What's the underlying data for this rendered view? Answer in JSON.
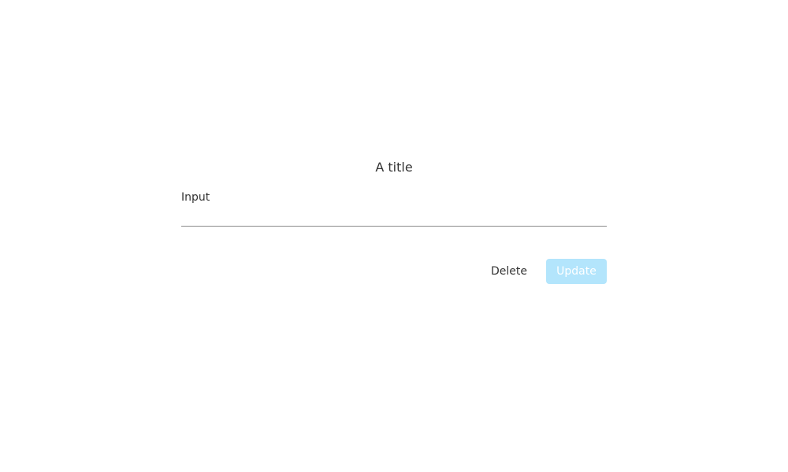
{
  "dialog": {
    "title": "A title",
    "input": {
      "label": "Input",
      "value": "",
      "placeholder": ""
    },
    "actions": {
      "delete_label": "Delete",
      "update_label": "Update",
      "update_disabled": true
    }
  },
  "colors": {
    "text": "#333333",
    "input_underline": "#8a8a8a",
    "update_button_bg": "#b3e5fc",
    "update_button_text": "#ffffff"
  }
}
